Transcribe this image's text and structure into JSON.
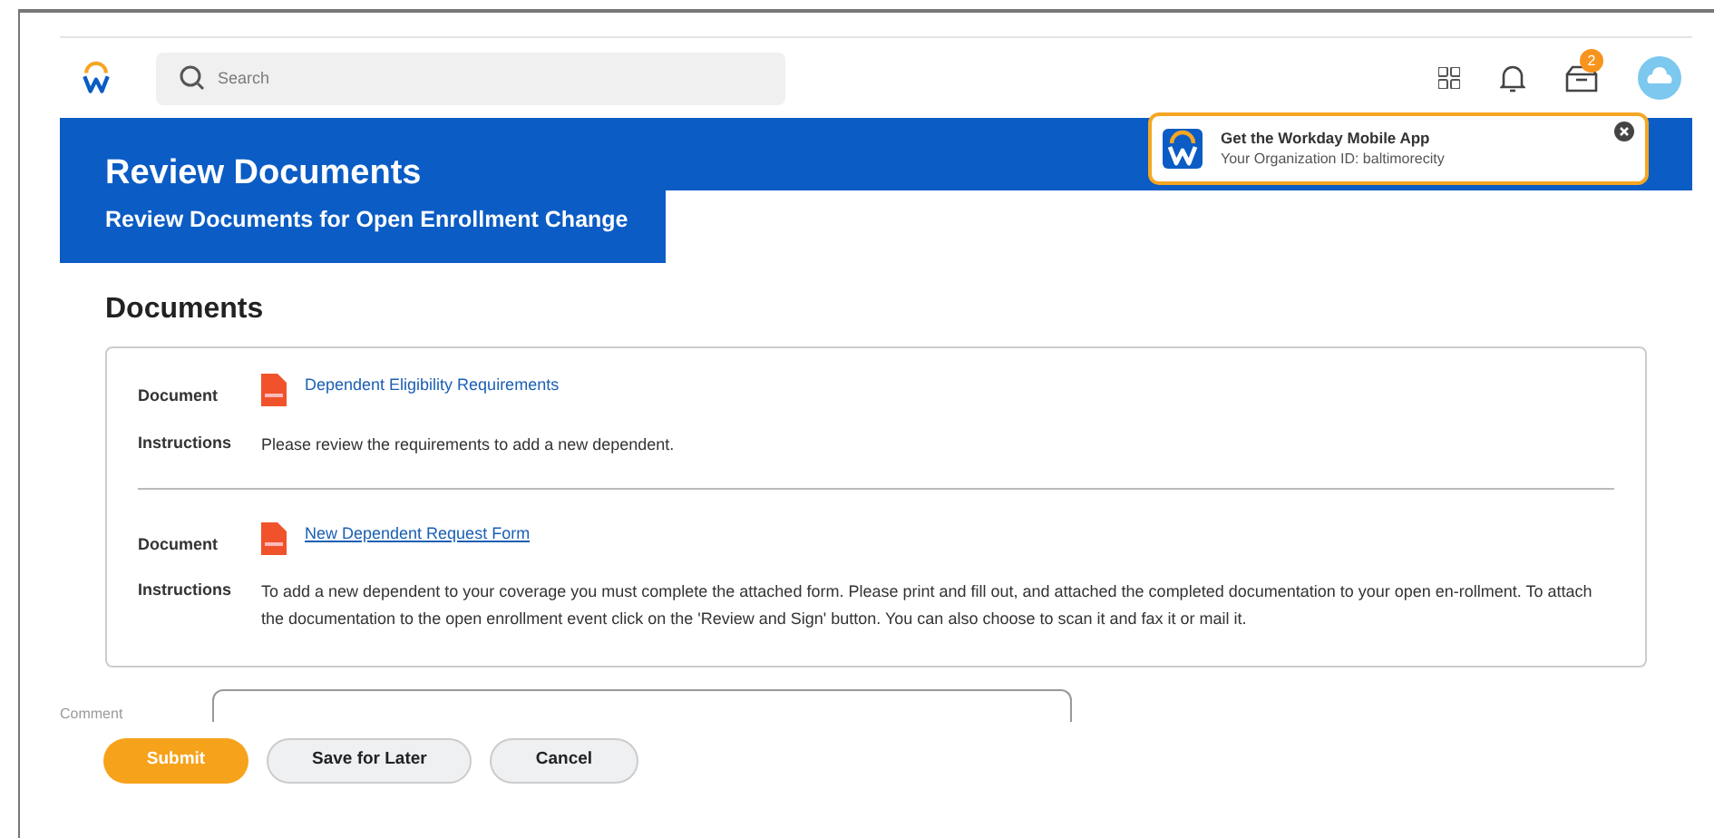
{
  "header": {
    "search": {
      "placeholder": "Search"
    },
    "inbox_badge": "2"
  },
  "toast": {
    "title": "Get the Workday Mobile App",
    "subtitle": "Your Organization ID: baltimorecity"
  },
  "banner": {
    "title": "Review Documents",
    "subtitle": "Review Documents for Open Enrollment Change"
  },
  "section_title": "Documents",
  "documents": [
    {
      "document_label": "Document",
      "name": "Dependent Eligibility Requirements",
      "underlined": false,
      "instructions_label": "Instructions",
      "instructions": "Please review the requirements to add a new dependent."
    },
    {
      "document_label": "Document",
      "name": "New Dependent Request Form",
      "underlined": true,
      "instructions_label": "Instructions",
      "instructions": "To add a new dependent to your coverage you must complete the attached form. Please print and fill out, and attached the completed documentation to your open en-rollment. To attach the documentation to the open enrollment event click on the 'Review and Sign' button. You can also choose to scan it and fax it or mail it."
    }
  ],
  "comment": {
    "label": "Comment"
  },
  "buttons": [
    {
      "label": "Submit",
      "kind": "primary"
    },
    {
      "label": "Save for Later",
      "kind": "secondary"
    },
    {
      "label": "Cancel",
      "kind": "secondary"
    }
  ]
}
